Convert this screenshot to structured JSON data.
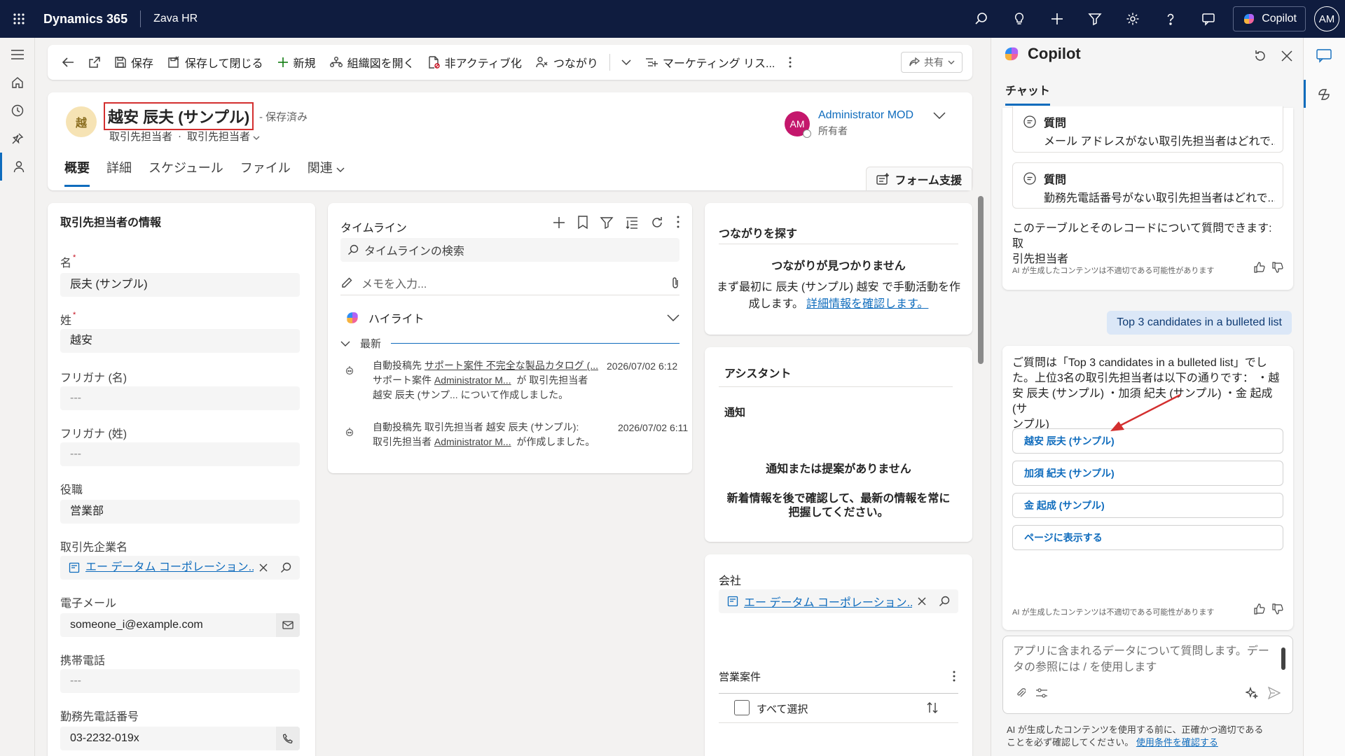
{
  "topbar": {
    "brand": "Dynamics 365",
    "app_name": "Zava HR",
    "copilot_label": "Copilot",
    "user_initials": "AM"
  },
  "commandbar": {
    "save": "保存",
    "save_close": "保存して閉じる",
    "new": "新規",
    "org_chart": "組織図を開く",
    "deactivate": "非アクティブ化",
    "connections": "つながり",
    "marketing_list": "マーケティング リス...",
    "share": "共有"
  },
  "record": {
    "avatar_initial": "越",
    "title": "越安 辰夫 (サンプル)",
    "saved_status": "- 保存済み",
    "entity_type": "取引先担当者",
    "form_name": "取引先担当者",
    "owner_initials": "AM",
    "owner_name": "Administrator MOD",
    "owner_role": "所有者",
    "tabs": [
      "概要",
      "詳細",
      "スケジュール",
      "ファイル",
      "関連"
    ],
    "form_assist": "フォーム支援"
  },
  "contact_info": {
    "section_title": "取引先担当者の情報",
    "first_name_label": "名",
    "first_name": "辰夫 (サンプル)",
    "last_name_label": "姓",
    "last_name": "越安",
    "furigana_first_label": "フリガナ (名)",
    "furigana_first": "---",
    "furigana_last_label": "フリガナ (姓)",
    "furigana_last": "---",
    "job_title_label": "役職",
    "job_title": "営業部",
    "company_label": "取引先企業名",
    "company": "エー データム コーポレーション...",
    "email_label": "電子メール",
    "email": "someone_i@example.com",
    "mobile_label": "携帯電話",
    "mobile": "---",
    "business_phone_label": "勤務先電話番号",
    "business_phone": "03-2232-019x"
  },
  "timeline": {
    "title": "タイムライン",
    "search_placeholder": "タイムラインの検索",
    "memo_placeholder": "メモを入力...",
    "highlight": "ハイライト",
    "latest": "最新",
    "posts": [
      {
        "prefix": "自動投稿先",
        "link1": "サポート案件 不完全な製品カタログ (...",
        "date": "2026/07/02 6:12",
        "line2_prefix": "サポート案件",
        "line2_link": "Administrator M...",
        "line2_suffix": "が 取引先担当者",
        "line3": "越安 辰夫 (サンプ... について作成しました。"
      },
      {
        "prefix": "自動投稿先 取引先担当者 越安 辰夫 (サンプル):",
        "date": "2026/07/02 6:11",
        "line2_prefix": "取引先担当者",
        "line2_link": "Administrator M...",
        "line2_suffix": "が作成しました。"
      }
    ]
  },
  "connections_card": {
    "title": "つながりを探す",
    "empty_title": "つながりが見つかりません",
    "empty_text1": "まず最初に 辰夫 (サンプル) 越安 で手動活動を作",
    "empty_text2": "成します。",
    "details_link": "詳細情報を確認します。"
  },
  "assistant_card": {
    "title": "アシスタント",
    "notification": "通知",
    "empty_title": "通知または提案がありません",
    "empty_text1": "新着情報を後で確認して、最新の情報を常に",
    "empty_text2": "把握してください。"
  },
  "company_card": {
    "label": "会社",
    "value": "エー データム コーポレーション...",
    "opportunities": "営業案件",
    "select_all": "すべて選択"
  },
  "copilot": {
    "title": "Copilot",
    "tab_chat": "チャット",
    "q_label": "質問",
    "q1": "メール アドレスがない取引先担当者はどれで...",
    "q2": "勤務先電話番号がない取引先担当者はどれで...",
    "intro1": "このテーブルとそのレコードについて質問できます: 取",
    "intro2": "引先担当者",
    "ai_disclaimer": "AI が生成したコンテンツは不適切である可能性があります",
    "user_msg": "Top 3 candidates in a bulleted list",
    "answer_lines": [
      "ご質問は「Top 3 candidates in a bulleted list」でし",
      "た。上位3名の取引先担当者は以下の通りです： ・越",
      "安 辰夫 (サンプル) ・加須 紀夫 (サンプル) ・金 起成 (サ",
      "ンプル)"
    ],
    "candidates": [
      "越安 辰夫 (サンプル)",
      "加須 紀夫 (サンプル)",
      "金 起成 (サンプル)"
    ],
    "show_on_page": "ページに表示する",
    "input_placeholder1": "アプリに含まれるデータについて質問します。デー",
    "input_placeholder2": "タの参照には / を使用します",
    "footer_text1": "AI が生成したコンテンツを使用する前に、正確かつ適切である",
    "footer_text2": "ことを必ず確認してください。",
    "terms_link": "使用条件を確認する"
  }
}
